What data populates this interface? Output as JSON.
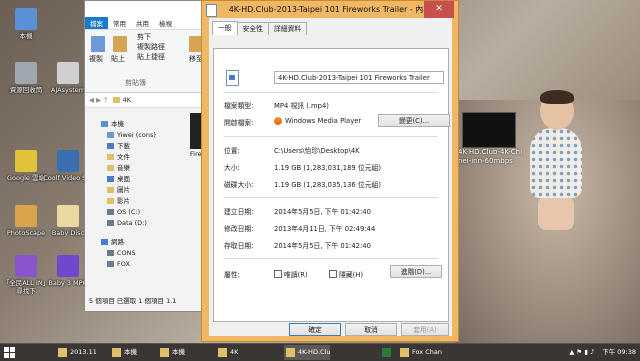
{
  "desktop": {
    "icons": [
      {
        "label": "本機",
        "color": "#5b8fd6"
      },
      {
        "label": "資源回收筒",
        "color": "#a0a7b0"
      },
      {
        "label": "AJAsystem",
        "color": "#cfcfcf"
      },
      {
        "label": "Google 雲端",
        "color": "#e2c23a"
      },
      {
        "label": "Coolf Video SW",
        "color": "#3a6fb0"
      },
      {
        "label": "PhotoScape",
        "color": "#d8a54a"
      },
      {
        "label": "Baby Disc",
        "color": "#e9d9a0"
      },
      {
        "label": "「全民ALL IN」尋找下",
        "color": "#8855cc"
      },
      {
        "label": "Baby 3 MPG",
        "color": "#6f49c9"
      }
    ],
    "right_label_line1": "4K-HD.Club-4K-Chi",
    "right_label_line2": "nei-inn-60mbps"
  },
  "explorer": {
    "ribbon_tabs": [
      "檔案",
      "常用",
      "共用",
      "檢視"
    ],
    "ribbon_buttons": {
      "copy": "複製",
      "paste": "貼上",
      "cut": "剪下",
      "copy_path": "複製路徑",
      "paste_shortcut": "貼上捷徑",
      "move": "移至",
      "clipboard": "剪貼簿"
    },
    "address": "4K",
    "nav": [
      {
        "label": "本機",
        "color": "#5b8fd6"
      },
      {
        "label": "Yiwei (cons)",
        "color": "#6c9ad0"
      },
      {
        "label": "下載",
        "color": "#4a7cc9"
      },
      {
        "label": "文件",
        "color": "#e0c068"
      },
      {
        "label": "音樂",
        "color": "#e0c068"
      },
      {
        "label": "桌面",
        "color": "#4a7cc9"
      },
      {
        "label": "圖片",
        "color": "#e0c068"
      },
      {
        "label": "影片",
        "color": "#e0c068"
      },
      {
        "label": "OS (C:)",
        "color": "#6b7a8a"
      },
      {
        "label": "Data (D:)",
        "color": "#6b7a8a"
      },
      {
        "label": "網路",
        "color": "#4a7cc9"
      },
      {
        "label": "CONS",
        "color": "#6b7a8a"
      },
      {
        "label": "FOX",
        "color": "#6b7a8a"
      }
    ],
    "status": "5 個項目   已選取 1 個項目 1.1",
    "thumb_caption": "Fire"
  },
  "dialog": {
    "title": "4K-HD.Club-2013-Taipei 101 Fireworks Trailer - 內容",
    "close": "✕",
    "tabs": [
      "一般",
      "安全性",
      "詳細資料"
    ],
    "filename": "4K-HD.Club-2013-Taipei 101 Fireworks Trailer",
    "labels": {
      "type": "檔案類型:",
      "opens_with": "開啟檔案:",
      "location": "位置:",
      "size": "大小:",
      "size_on_disk": "磁碟大小:",
      "created": "建立日期:",
      "modified": "修改日期:",
      "accessed": "存取日期:",
      "attributes": "屬性:"
    },
    "values": {
      "type": "MP4 視訊 (.mp4)",
      "opens_with": "Windows Media Player",
      "location": "C:\\Users\\怡珍\\Desktop\\4K",
      "size": "1.19 GB (1,283,031,189 位元組)",
      "size_on_disk": "1.19 GB (1,283,035,136 位元組)",
      "created": "2014年5月5日, 下午 01:42:40",
      "modified": "2013年4月11日, 下午 02:49:44",
      "accessed": "2014年5月5日, 下午 01:42:40"
    },
    "change_button": "變更(C)...",
    "readonly": "唯讀(R)",
    "hidden": "隱藏(H)",
    "advanced_button": "進階(D)...",
    "ok": "確定",
    "cancel": "取消",
    "apply": "套用(A)"
  },
  "taskbar": {
    "items": [
      {
        "label": "2013.11",
        "color": "#e0c068",
        "active": false
      },
      {
        "label": "本機",
        "color": "#e0c068",
        "active": false
      },
      {
        "label": "本機",
        "color": "#e0c068",
        "active": false
      },
      {
        "label": "4K",
        "color": "#e0c068",
        "active": false
      },
      {
        "label": "4K-HD.Clu",
        "color": "#e0c068",
        "active": true
      },
      {
        "label": "",
        "color": "#2a7a3a",
        "active": false
      },
      {
        "label": "Fox Chan",
        "color": "#e0c068",
        "active": false
      }
    ],
    "tray_time": "下午 09:38"
  }
}
